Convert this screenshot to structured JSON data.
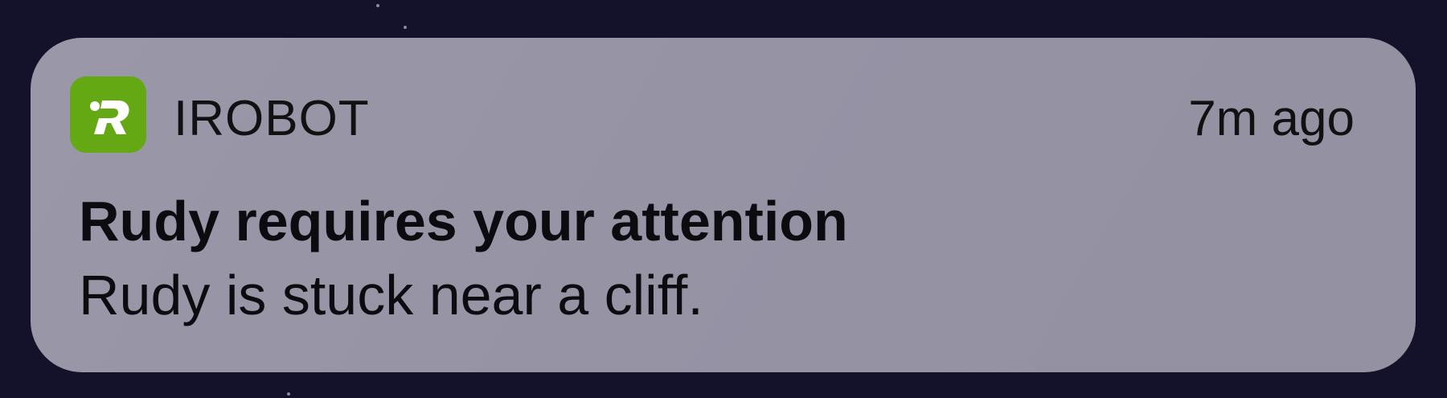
{
  "notification": {
    "app_name": "IROBOT",
    "app_icon": "irobot-logo-icon",
    "app_icon_color": "#64a814",
    "timestamp": "7m ago",
    "title": "Rudy requires your attention",
    "message": "Rudy is stuck near a cliff."
  }
}
